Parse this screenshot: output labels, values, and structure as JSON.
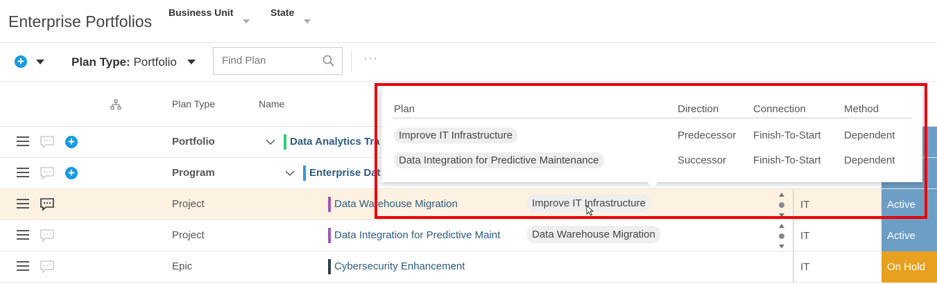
{
  "header": {
    "title": "Enterprise Portfolios",
    "filters": [
      {
        "label": "Business Unit"
      },
      {
        "label": "State"
      }
    ]
  },
  "toolbar": {
    "plan_type_label": "Plan Type:",
    "plan_type_value": "Portfolio",
    "search_placeholder": "Find Plan",
    "more_label": "···"
  },
  "columns": {
    "plan_type": "Plan Type",
    "name": "Name"
  },
  "rows": [
    {
      "plan_type": "Portfolio",
      "name": "Data Analytics Tra",
      "bar_color": "#2ecc71",
      "has_add": true,
      "expanded": true
    },
    {
      "plan_type": "Program",
      "name": "Enterprise Dat",
      "bar_color": "#2e9bd6",
      "has_add": true,
      "expanded": true
    },
    {
      "plan_type": "Project",
      "name": "Data Warehouse Migration",
      "bar_color": "#9b59b6",
      "dependency": "Improve IT Infrastructure",
      "dept": "IT",
      "status": "Active",
      "status_color": "#6d9ec5"
    },
    {
      "plan_type": "Project",
      "name": "Data Integration for Predictive Maint",
      "bar_color": "#9b59b6",
      "dependency": "Data Warehouse Migration",
      "dept": "IT",
      "status": "Active",
      "status_color": "#6d9ec5"
    },
    {
      "plan_type": "Epic",
      "name": "Cybersecurity Enhancement",
      "bar_color": "#2c3e50",
      "dept": "IT",
      "status": "On Hold",
      "status_color": "#e8a020"
    }
  ],
  "popup": {
    "headers": {
      "plan": "Plan",
      "direction": "Direction",
      "connection": "Connection",
      "method": "Method"
    },
    "rows": [
      {
        "plan": "Improve IT Infrastructure",
        "direction": "Predecessor",
        "connection": "Finish-To-Start",
        "method": "Dependent"
      },
      {
        "plan": "Data Integration for Predictive Maintenance",
        "direction": "Successor",
        "connection": "Finish-To-Start",
        "method": "Dependent"
      }
    ]
  },
  "colors": {
    "accent": "#1a9ae0",
    "selected_row": "#fdf1e1",
    "highlight": "#e8000b"
  }
}
